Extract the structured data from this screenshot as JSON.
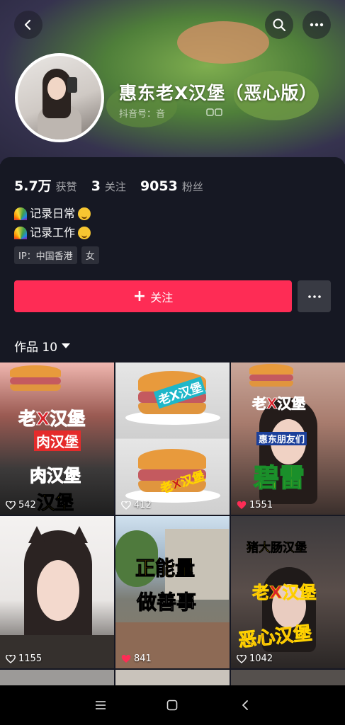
{
  "profile": {
    "nickname": "惠东老X汉堡（恶心版）",
    "douyin_id": "抖音号：音",
    "stats": [
      {
        "value": "5.7万",
        "label": "获赞"
      },
      {
        "value": "3",
        "label": "关注"
      },
      {
        "value": "9053",
        "label": "粉丝"
      }
    ],
    "bio": [
      "记录日常",
      "记录工作"
    ],
    "tags": [
      "IP：中国香港",
      "女"
    ],
    "follow_label": "关注",
    "works_label": "作品 10"
  },
  "videos": [
    {
      "likes": "542",
      "liked": false,
      "captions": [
        "老X汉堡",
        "肉汉堡",
        "肉汉堡",
        "汉堡"
      ]
    },
    {
      "likes": "412",
      "liked": false,
      "captions": [
        "老X汉堡",
        "老X汉堡"
      ]
    },
    {
      "likes": "1551",
      "liked": true,
      "captions": [
        "老X汉堡",
        "惠东朋友们",
        "碧雷"
      ]
    },
    {
      "likes": "1155",
      "liked": false,
      "captions": []
    },
    {
      "likes": "841",
      "liked": true,
      "captions": [
        "正能量",
        "做善事"
      ]
    },
    {
      "likes": "1042",
      "liked": false,
      "captions": [
        "猪大肠汉堡",
        "老X汉堡",
        "恶心汉堡"
      ]
    }
  ],
  "colors": {
    "accent": "#fe2c55",
    "background": "#161823"
  },
  "icons": [
    "back-icon",
    "search-icon",
    "more-icon",
    "copy-icon",
    "plus-icon",
    "dropdown-icon",
    "heart-icon",
    "menu-icon",
    "home-square-icon",
    "back-triangle-icon"
  ]
}
